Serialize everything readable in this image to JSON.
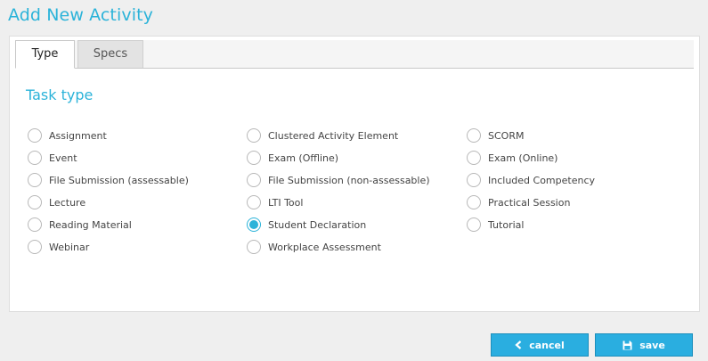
{
  "page": {
    "title": "Add New Activity"
  },
  "tabs": [
    {
      "label": "Type",
      "active": true
    },
    {
      "label": "Specs",
      "active": false
    }
  ],
  "task_type": {
    "title": "Task type",
    "selected": "Student Declaration",
    "columns": [
      [
        "Assignment",
        "Event",
        "File Submission (assessable)",
        "Lecture",
        "Reading Material",
        "Webinar"
      ],
      [
        "Clustered Activity Element",
        "Exam (Offline)",
        "File Submission (non-assessable)",
        "LTI Tool",
        "Student Declaration",
        "Workplace Assessment"
      ],
      [
        "SCORM",
        "Exam (Online)",
        "Included Competency",
        "Practical Session",
        "Tutorial"
      ]
    ]
  },
  "buttons": {
    "cancel_label": "cancel",
    "save_label": "save"
  },
  "colors": {
    "accent": "#2bb3d9",
    "button": "#2aaee0"
  },
  "icons": {
    "cancel": "chevron-left-icon",
    "save": "floppy-disk-icon"
  }
}
